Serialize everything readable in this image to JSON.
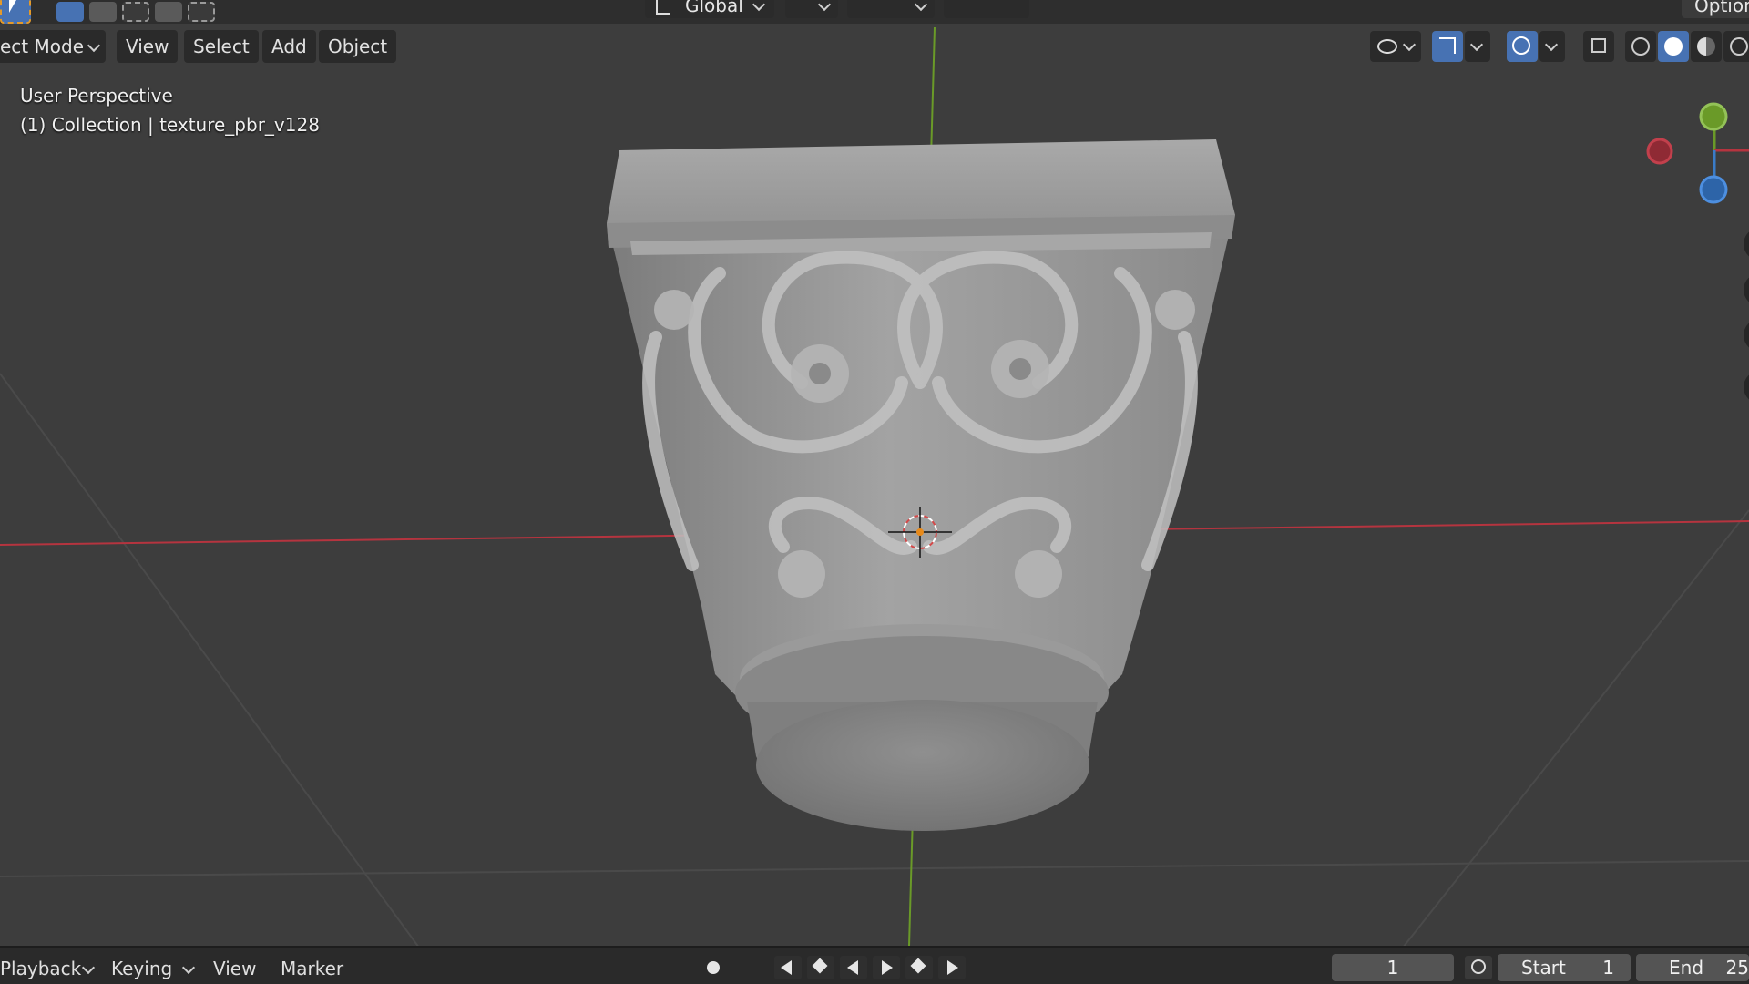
{
  "toolbar": {
    "transform_orientation": "Global",
    "options_label": "Option"
  },
  "header": {
    "mode": "ect Mode",
    "menus": [
      "View",
      "Select",
      "Add",
      "Object"
    ]
  },
  "viewport": {
    "perspective": "User Perspective",
    "collection": "(1) Collection | texture_pbr_v128"
  },
  "timeline": {
    "playback": "Playback",
    "keying": "Keying",
    "view": "View",
    "marker": "Marker",
    "current_frame": "1",
    "start_label": "Start",
    "start_value": "1",
    "end_label": "End",
    "end_value": "25"
  },
  "colors": {
    "x_axis": "#b5343f",
    "y_axis": "#6a9a28",
    "z_axis": "#3a7cc8",
    "accent": "#4772b3"
  }
}
